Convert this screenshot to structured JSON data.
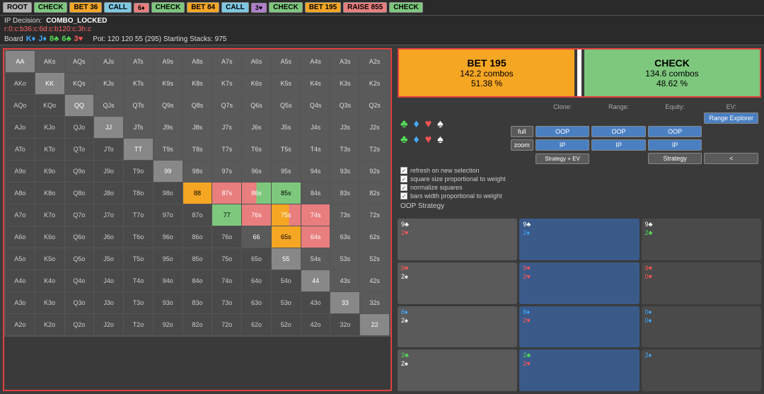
{
  "topbar": {
    "buttons": [
      {
        "id": "root",
        "label": "ROOT",
        "cls": "btn-root"
      },
      {
        "id": "check1",
        "label": "CHECK",
        "cls": "btn-check"
      },
      {
        "id": "bet36",
        "label": "BET 36",
        "cls": "btn-bet36"
      },
      {
        "id": "call1",
        "label": "CALL",
        "cls": "btn-call"
      },
      {
        "id": "6plus",
        "label": "6♦",
        "cls": "btn-6plus"
      },
      {
        "id": "check2",
        "label": "CHECK",
        "cls": "btn-check"
      },
      {
        "id": "bet84",
        "label": "BET 84",
        "cls": "btn-bet84"
      },
      {
        "id": "call2",
        "label": "CALL",
        "cls": "btn-call"
      },
      {
        "id": "3v",
        "label": "3♥",
        "cls": "btn-3v"
      },
      {
        "id": "check3",
        "label": "CHECK",
        "cls": "btn-check2"
      },
      {
        "id": "bet195",
        "label": "BET 195",
        "cls": "btn-bet195"
      },
      {
        "id": "raise855",
        "label": "RAISE 855",
        "cls": "btn-raise855"
      },
      {
        "id": "check4",
        "label": "CHECK",
        "cls": "btn-check3"
      }
    ]
  },
  "infobar": {
    "decision_label": "IP Decision:",
    "decision_value": "COMBO_LOCKED",
    "range_line": "r:0:c:b36:c:6d:c:b120:c:3h:c",
    "board_label": "Board",
    "cards": [
      {
        "label": "K♦",
        "cls": "card-k-d"
      },
      {
        "label": "J♦",
        "cls": "card-j-d"
      },
      {
        "label": "8♣",
        "cls": "card-8-c"
      },
      {
        "label": "6♣",
        "cls": "card-6-c"
      },
      {
        "label": "3♥",
        "cls": "card-3-h"
      }
    ],
    "pot": "Pot: 120 120 55 (295) Starting Stacks: 975"
  },
  "action_summary": {
    "bet": {
      "label": "BET 195",
      "combos": "142.2 combos",
      "pct": "51.38 %"
    },
    "check": {
      "label": "CHECK",
      "combos": "134.6 combos",
      "pct": "48.62 %"
    }
  },
  "controls": {
    "suits_row1": [
      "♣",
      "♦",
      "♥",
      "♠"
    ],
    "suits_row2": [
      "♣",
      "♦",
      "♥",
      "♠"
    ],
    "headers": [
      "Clone:",
      "Range:",
      "Equity:",
      "EV:"
    ],
    "range_explorer_label": "Range Explorer",
    "row1": [
      "full",
      "OOP",
      "OOP",
      "OOP"
    ],
    "row2": [
      "zoom",
      "IP",
      "IP",
      "IP"
    ],
    "strategy_ev": "Strategy + EV",
    "strategy": "Strategy",
    "lt": "<",
    "checkboxes": [
      "refresh on new selection",
      "square size proportional to weight",
      "normalize squares",
      "bars width proportional to weight"
    ],
    "oop_strategy": "OOP Strategy"
  },
  "card_cells": [
    {
      "top": "9♣",
      "top_cls": "c-spade",
      "bot": "2♥",
      "bot_cls": "c-heart",
      "cls": "card-cell"
    },
    {
      "top": "9♣",
      "top_cls": "c-spade",
      "bot": "2♦",
      "bot_cls": "c-diamond",
      "cls": "card-cell card-cell-blue"
    },
    {
      "top": "9♣",
      "top_cls": "c-spade",
      "bot": "2♣",
      "bot_cls": "c-club",
      "cls": "card-cell card-cell-dark"
    },
    {
      "top": "9♥",
      "top_cls": "c-heart",
      "bot": "2♠",
      "bot_cls": "c-spade",
      "cls": "card-cell"
    },
    {
      "top": "9♥",
      "top_cls": "c-heart",
      "bot": "2♥",
      "bot_cls": "c-heart",
      "cls": "card-cell card-cell-blue"
    },
    {
      "top": "9♥",
      "top_cls": "c-heart",
      "bot": "0♥",
      "bot_cls": "c-heart",
      "cls": "card-cell card-cell-dark"
    },
    {
      "top": "8♦",
      "top_cls": "c-diamond",
      "bot": "2♠",
      "bot_cls": "c-spade",
      "cls": "card-cell"
    },
    {
      "top": "8♦",
      "top_cls": "c-diamond",
      "bot": "2♥",
      "bot_cls": "c-heart",
      "cls": "card-cell card-cell-blue"
    },
    {
      "top": "0♦",
      "top_cls": "c-diamond",
      "bot": "0♦",
      "bot_cls": "c-diamond",
      "cls": "card-cell card-cell-dark"
    },
    {
      "top": "2♣",
      "top_cls": "c-club",
      "bot": "2♠",
      "bot_cls": "c-spade",
      "cls": "card-cell"
    },
    {
      "top": "2♣",
      "top_cls": "c-club",
      "bot": "2♥",
      "bot_cls": "c-heart",
      "cls": "card-cell card-cell-blue"
    },
    {
      "top": "2♦",
      "top_cls": "c-diamond",
      "bot": "",
      "bot_cls": "",
      "cls": "card-cell card-cell-dark"
    }
  ],
  "grid": {
    "rows": [
      [
        "AA",
        "AKs",
        "AQs",
        "AJs",
        "ATs",
        "A9s",
        "A8s",
        "A7s",
        "A6s",
        "A5s",
        "A4s",
        "A3s",
        "A2s"
      ],
      [
        "AKo",
        "KK",
        "KQs",
        "KJs",
        "KTs",
        "K9s",
        "K8s",
        "K7s",
        "K6s",
        "K5s",
        "K4s",
        "K3s",
        "K2s"
      ],
      [
        "AQo",
        "KQo",
        "QQ",
        "QJs",
        "QTs",
        "Q9s",
        "Q8s",
        "Q7s",
        "Q6s",
        "Q5s",
        "Q4s",
        "Q3s",
        "Q2s"
      ],
      [
        "AJo",
        "KJo",
        "QJo",
        "JJ",
        "JTs",
        "J9s",
        "J8s",
        "J7s",
        "J6s",
        "J5s",
        "J4s",
        "J3s",
        "J2s"
      ],
      [
        "ATo",
        "KTo",
        "QTo",
        "JTo",
        "TT",
        "T9s",
        "T8s",
        "T7s",
        "T6s",
        "T5s",
        "T4s",
        "T3s",
        "T2s"
      ],
      [
        "A9o",
        "K9o",
        "Q9o",
        "J9o",
        "T9o",
        "99",
        "98s",
        "97s",
        "96s",
        "95s",
        "94s",
        "93s",
        "92s"
      ],
      [
        "A8o",
        "K8o",
        "Q8o",
        "J8o",
        "T8o",
        "98o",
        "88",
        "87s",
        "86s",
        "85s",
        "84s",
        "83s",
        "82s"
      ],
      [
        "A7o",
        "K7o",
        "Q7o",
        "J7o",
        "T7o",
        "97o",
        "87o",
        "77",
        "76s",
        "75s",
        "74s",
        "73s",
        "72s"
      ],
      [
        "A6o",
        "K6o",
        "Q6o",
        "J6o",
        "T6o",
        "96o",
        "86o",
        "76o",
        "66",
        "65s",
        "64s",
        "63s",
        "62s"
      ],
      [
        "A5o",
        "K5o",
        "Q5o",
        "J5o",
        "T5o",
        "95o",
        "85o",
        "75o",
        "65o",
        "55",
        "54s",
        "53s",
        "52s"
      ],
      [
        "A4o",
        "K4o",
        "Q4o",
        "J4o",
        "T4o",
        "94o",
        "84o",
        "74o",
        "64o",
        "54o",
        "44",
        "43s",
        "42s"
      ],
      [
        "A3o",
        "K3o",
        "Q3o",
        "J3o",
        "T3o",
        "93o",
        "83o",
        "73o",
        "63o",
        "53o",
        "43o",
        "33",
        "32s"
      ],
      [
        "A2o",
        "K2o",
        "Q2o",
        "J2o",
        "T2o",
        "92o",
        "82o",
        "72o",
        "62o",
        "52o",
        "42o",
        "32o",
        "22"
      ]
    ],
    "cell_colors": {
      "AA": "pair",
      "KK": "pair",
      "QQ": "pair",
      "JJ": "pair",
      "TT": "pair",
      "99": "pair",
      "88": "orange",
      "77": "green",
      "66": "default",
      "55": "pair",
      "44": "pair",
      "33": "pair",
      "22": "pair",
      "87s": "red",
      "86s": "mixed",
      "85s": "green",
      "76s": "red",
      "75s": "orange-red",
      "74s": "red",
      "65s": "orange",
      "64s": "red"
    }
  }
}
